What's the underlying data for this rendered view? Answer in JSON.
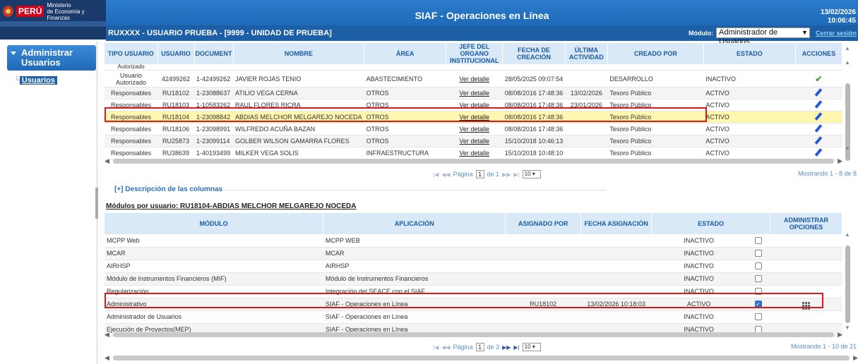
{
  "header": {
    "logo_country": "PERÚ",
    "logo_ministry_line1": "Ministerio",
    "logo_ministry_line2": "de Economía y Finanzas",
    "app_title": "SIAF - Operaciones en Línea",
    "date": "13/02/2026",
    "time": "10:06:45",
    "user_info": "RUXXXX - USUARIO PRUEBA - [9999 - UNIDAD DE PRUEBA]",
    "module_label": "Módulo:",
    "module_value": "Administrador de Usuarios",
    "logout": "Cerrar sesión"
  },
  "sidebar": {
    "section_title_line1": "Administrar",
    "section_title_line2": "Usuarios",
    "item": "Usuarios"
  },
  "users_table": {
    "headers": [
      "TIPO USUARIO",
      "USUARIO",
      "DOCUMENT",
      "NOMBRE",
      "ÁREA",
      "JEFE DEL ORGANO INSTITUCIONAL",
      "FECHA DE CREACIÓN",
      "ÚLTIMA ACTIVIDAD",
      "CREADO POR",
      "ESTADO",
      "ACCIONES"
    ],
    "partial_row": "Autorizado",
    "rows": [
      {
        "tipo": "Usuario Autorizado",
        "usuario": "42499262",
        "documento": "1-42499262",
        "nombre": "JAVIER ROJAS TENIO",
        "area": "ABASTECIMIENTO",
        "jefe": "Ver detalle",
        "fecha": "28/05/2025 09:07:54",
        "ultima": "",
        "creado": "DESARROLLO",
        "estado": "INACTIVO",
        "accion": "check"
      },
      {
        "tipo": "Responsables",
        "usuario": "RU18102",
        "documento": "1-23088637",
        "nombre": "ATILIO VEGA CERNA",
        "area": "OTROS",
        "jefe": "Ver detalle",
        "fecha": "08/08/2016 17:48:36",
        "ultima": "13/02/2026",
        "creado": "Tesoro Público",
        "estado": "ACTIVO",
        "accion": "edit"
      },
      {
        "tipo": "Responsables",
        "usuario": "RU18103",
        "documento": "1-10583262",
        "nombre": "RAUL FLORES RICRA",
        "area": "OTROS",
        "jefe": "Ver detalle",
        "fecha": "08/08/2016 17:48:36",
        "ultima": "23/01/2026",
        "creado": "Tesoro Público",
        "estado": "ACTIVO",
        "accion": "edit"
      },
      {
        "tipo": "Responsables",
        "usuario": "RU18104",
        "documento": "1-23098842",
        "nombre": "ABDIAS MELCHOR MELGAREJO NOCEDA",
        "area": "OTROS",
        "jefe": "Ver detalle",
        "fecha": "08/08/2016 17:48:36",
        "ultima": "",
        "creado": "Tesoro Público",
        "estado": "ACTIVO",
        "accion": "edit"
      },
      {
        "tipo": "Responsables",
        "usuario": "RU18106",
        "documento": "1-23098991",
        "nombre": "WILFREDO ACUÑA BAZAN",
        "area": "OTROS",
        "jefe": "Ver detalle",
        "fecha": "08/08/2016 17:48:36",
        "ultima": "",
        "creado": "Tesoro Público",
        "estado": "ACTIVO",
        "accion": "edit"
      },
      {
        "tipo": "Responsables",
        "usuario": "RU25873",
        "documento": "1-23099114",
        "nombre": "GOLBER WILSON GAMARRA FLORES",
        "area": "OTROS",
        "jefe": "Ver detalle",
        "fecha": "15/10/2018 10:46:13",
        "ultima": "",
        "creado": "Tesoro Público",
        "estado": "ACTIVO",
        "accion": "edit"
      },
      {
        "tipo": "Responsables",
        "usuario": "RU38639",
        "documento": "1-40193499",
        "nombre": "MILKER VEGA SOLIS",
        "area": "INFRAESTRUCTURA",
        "jefe": "Ver detalle",
        "fecha": "15/10/2018 10:48:10",
        "ultima": "",
        "creado": "Tesoro Público",
        "estado": "ACTIVO",
        "accion": "edit"
      }
    ],
    "pager": {
      "page_label": "Página",
      "page": "1",
      "of_label": "de 1",
      "per_page": "10",
      "summary": "Mostrando 1 - 8 de 8"
    }
  },
  "description_link": "[+] Descripción de las columnas",
  "modules_title": "Módulos por usuario: RU18104-ABDIAS MELCHOR MELGAREJO NOCEDA",
  "modules_table": {
    "headers": [
      "MÓDULO",
      "APLICACIÓN",
      "ASIGNADO POR",
      "FECHA ASIGNACIÓN",
      "ESTADO",
      "ADMINISTRAR OPCIONES"
    ],
    "rows": [
      {
        "modulo": "MCPP Web",
        "aplicacion": "MCPP WEB",
        "asignado": "",
        "fecha": "",
        "estado": "INACTIVO",
        "checked": false,
        "opciones": false
      },
      {
        "modulo": "MCAR",
        "aplicacion": "MCAR",
        "asignado": "",
        "fecha": "",
        "estado": "INACTIVO",
        "checked": false,
        "opciones": false
      },
      {
        "modulo": "AIRHSP",
        "aplicacion": "AIRHSP",
        "asignado": "",
        "fecha": "",
        "estado": "INACTIVO",
        "checked": false,
        "opciones": false
      },
      {
        "modulo": "Módulo de Instrumentos Financieros (MIF)",
        "aplicacion": "Módulo de Instrumentos Financieros",
        "asignado": "",
        "fecha": "",
        "estado": "INACTIVO",
        "checked": false,
        "opciones": false
      },
      {
        "modulo": "Regularización",
        "aplicacion": "Integración del SEACE con el SIAF",
        "asignado": "",
        "fecha": "",
        "estado": "INACTIVO",
        "checked": false,
        "opciones": false
      },
      {
        "modulo": "Administrativo",
        "aplicacion": "SIAF - Operaciones en Línea",
        "asignado": "RU18102",
        "fecha": "13/02/2026 10:18:03",
        "estado": "ACTIVO",
        "checked": true,
        "opciones": true
      },
      {
        "modulo": "Administrador de Usuarios",
        "aplicacion": "SIAF - Operaciones en Línea",
        "asignado": "",
        "fecha": "",
        "estado": "INACTIVO",
        "checked": false,
        "opciones": false
      },
      {
        "modulo": "Ejecución de Proyectos(MEP)",
        "aplicacion": "SIAF - Operaciones en Línea",
        "asignado": "",
        "fecha": "",
        "estado": "INACTIVO",
        "checked": false,
        "opciones": false
      }
    ],
    "pager": {
      "page_label": "Página",
      "page": "1",
      "of_label": "de 3",
      "per_page": "10",
      "summary": "Mostrando 1 - 10 de 21"
    }
  },
  "colors": {
    "header_blue": "#1e6ab8",
    "highlight_red": "#d61b1b",
    "selected_row": "#fff7b0",
    "table_header": "#d9e9f8"
  }
}
